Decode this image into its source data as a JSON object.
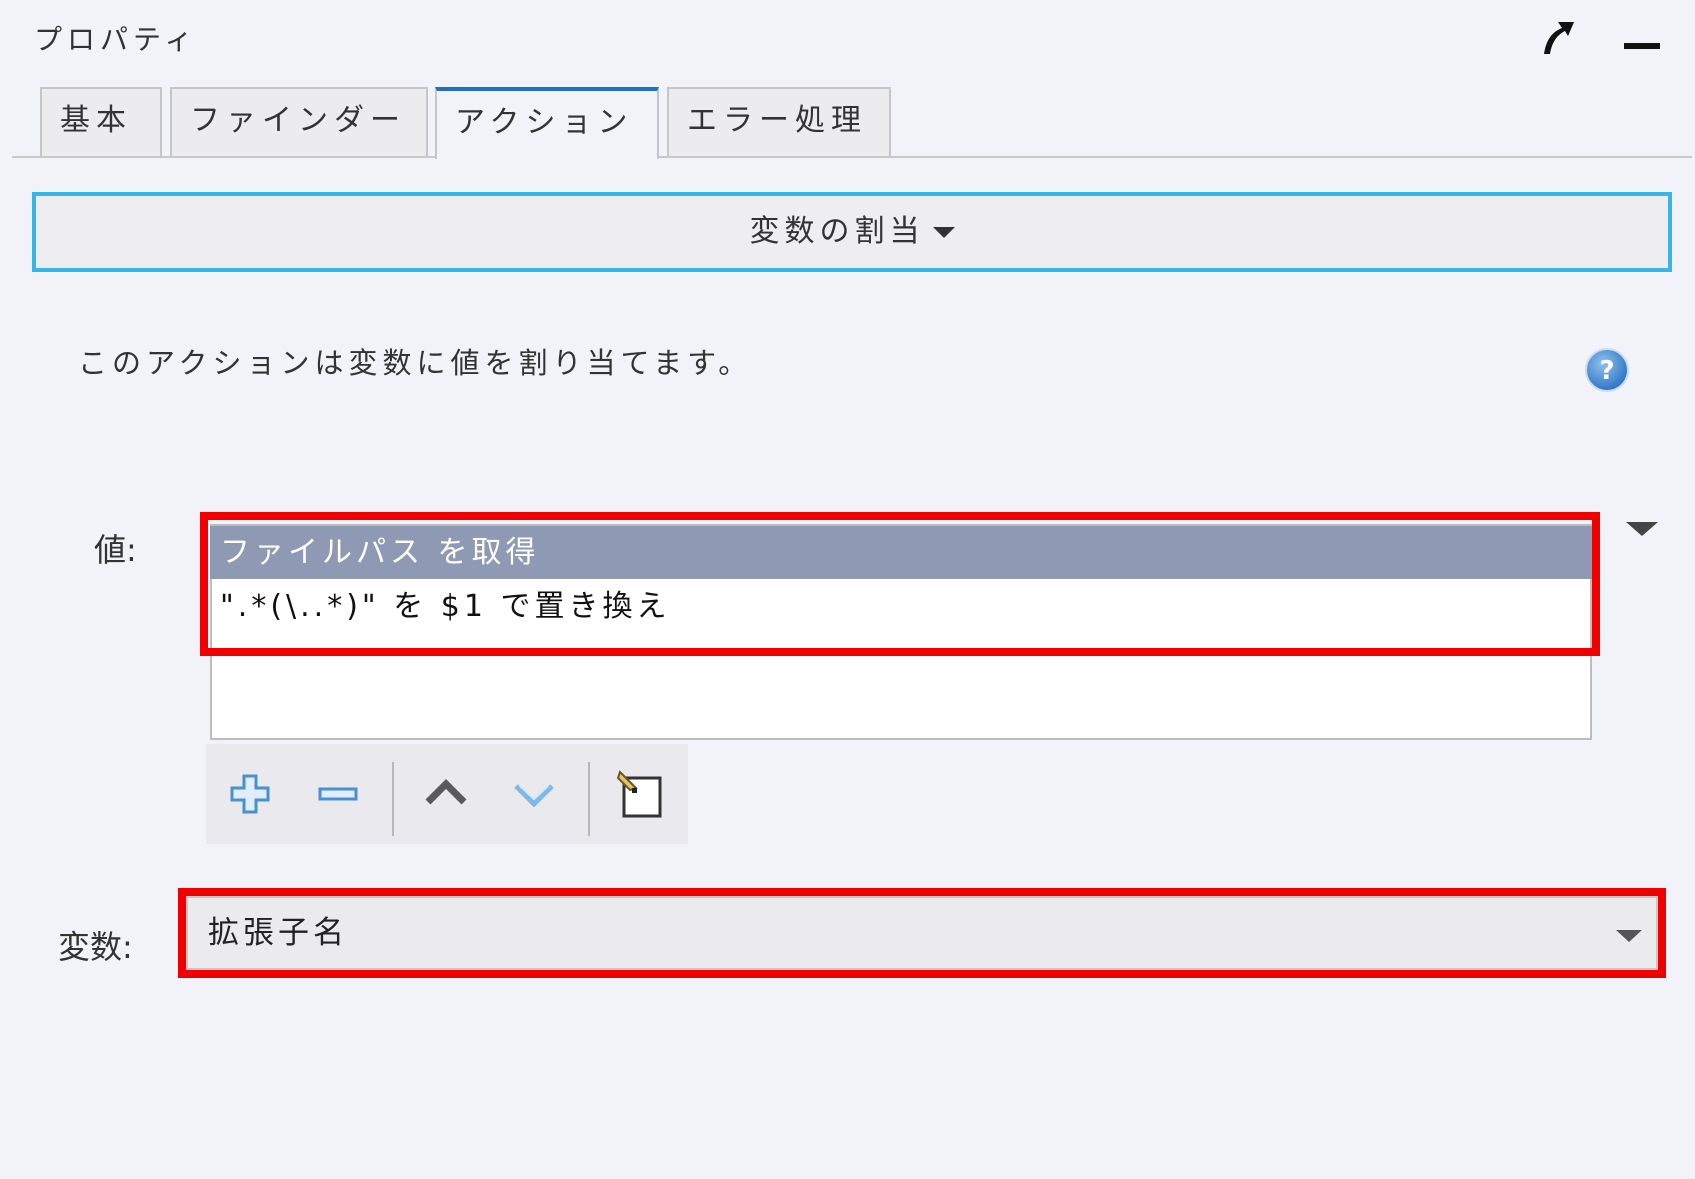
{
  "panel": {
    "title": "プロパティ"
  },
  "tabs": [
    {
      "label": "基本",
      "active": false
    },
    {
      "label": "ファインダー",
      "active": false
    },
    {
      "label": "アクション",
      "active": true
    },
    {
      "label": "エラー処理",
      "active": false
    }
  ],
  "action": {
    "selected_label": "変数の割当",
    "description": "このアクションは変数に値を割り当てます。"
  },
  "value": {
    "label": "値:",
    "items": [
      {
        "text": "ファイルパス を取得",
        "selected": true
      },
      {
        "text": "\".*(\\..*)\" を $1 で置き換え",
        "selected": false
      }
    ]
  },
  "toolbar": {
    "buttons": [
      "plus-icon",
      "minus-icon",
      "chevron-up-icon",
      "chevron-down-icon",
      "edit-icon"
    ]
  },
  "variable": {
    "label": "変数:",
    "selected_value": "拡張子名"
  },
  "colors": {
    "accent_blue": "#35b5e8",
    "active_tab_border": "#1f6fc2",
    "highlight_red": "#f00000",
    "selected_row": "#8e9ab4"
  }
}
